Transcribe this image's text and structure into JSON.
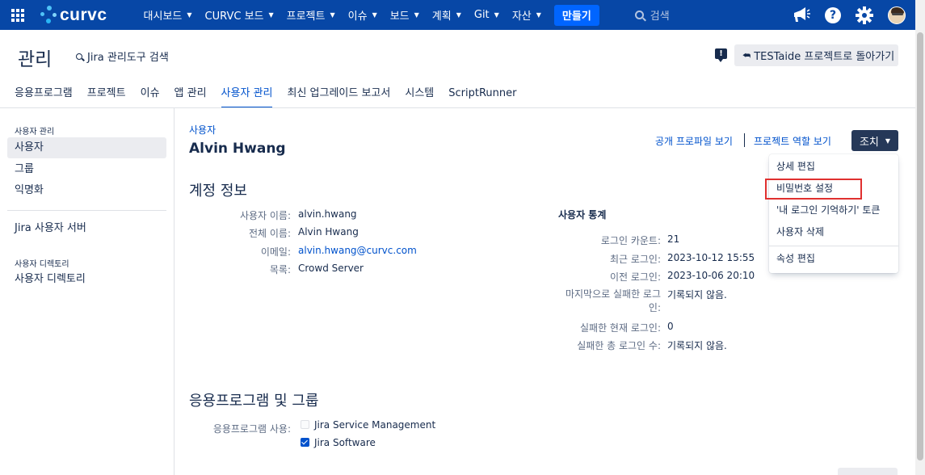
{
  "topnav": {
    "logo_text": "curvc",
    "items": [
      {
        "label": "대시보드"
      },
      {
        "label": "CURVC 보드"
      },
      {
        "label": "프로젝트"
      },
      {
        "label": "이슈"
      },
      {
        "label": "보드"
      },
      {
        "label": "계획"
      },
      {
        "label": "Git"
      },
      {
        "label": "자산"
      }
    ],
    "create_label": "만들기",
    "search_placeholder": "검색",
    "help_label": "?"
  },
  "admin": {
    "title": "관리",
    "search_label": "Jira 관리도구 검색",
    "feedback_icon_label": "!",
    "back_label": "TESTaide 프로젝트로 돌아가기",
    "back_arrow": "⮪",
    "tabs": [
      {
        "label": "응용프로그램"
      },
      {
        "label": "프로젝트"
      },
      {
        "label": "이슈"
      },
      {
        "label": "앱 관리"
      },
      {
        "label": "사용자 관리"
      },
      {
        "label": "최신 업그레이드 보고서"
      },
      {
        "label": "시스템"
      },
      {
        "label": "ScriptRunner"
      }
    ],
    "active_tab": "사용자 관리"
  },
  "sidebar": {
    "heading_users": "사용자 관리",
    "items": [
      {
        "label": "사용자"
      },
      {
        "label": "그룹"
      },
      {
        "label": "익명화"
      },
      {
        "label": "Jira 사용자 서버"
      }
    ],
    "heading_directory": "사용자 디렉토리",
    "directory_item": "사용자 디렉토리"
  },
  "main": {
    "breadcrumb": "사용자",
    "user_name": "Alvin Hwang",
    "link_profile": "공개 프로파일 보기",
    "link_roles": "프로젝트 역할 보기",
    "actions_label": "조치",
    "account_title": "계정 정보",
    "account": [
      {
        "label": "사용자 이름:",
        "value": "alvin.hwang"
      },
      {
        "label": "전체 이름:",
        "value": "Alvin Hwang"
      },
      {
        "label": "이메일:",
        "value": "alvin.hwang@curvc.com"
      },
      {
        "label": "목록:",
        "value": "Crowd Server"
      }
    ],
    "stats_title": "사용자 통계",
    "stats": [
      {
        "label": "로그인 카운트:",
        "value": "21"
      },
      {
        "label": "최근 로그인:",
        "value": "2023-10-12 15:55"
      },
      {
        "label": "이전 로그인:",
        "value": "2023-10-06 20:10"
      },
      {
        "label": "마지막으로 실패한 로그인:",
        "value": "기록되지 않음."
      },
      {
        "label": "실패한 현재 로그인:",
        "value": "0"
      },
      {
        "label": "실패한 총 로그인 수:",
        "value": "기록되지 않음."
      }
    ],
    "apps_title": "응용프로그램 및 그룹",
    "apps_label": "응용프로그램 사용:",
    "apps": [
      {
        "label": "Jira Service Management",
        "checked": false
      },
      {
        "label": "Jira Software",
        "checked": true
      }
    ]
  },
  "dropdown": {
    "items": [
      {
        "label": "상세 편집"
      },
      {
        "label": "비밀번호 설정"
      },
      {
        "label": "'내 로그인 기억하기' 토큰"
      },
      {
        "label": "사용자 삭제"
      },
      {
        "label": "속성 편집"
      }
    ],
    "highlighted": "비밀번호 설정",
    "highlight_color": "#e0302f"
  },
  "colors": {
    "nav_bg": "#0747a6",
    "link": "#0052cc",
    "actions_bg": "#253858"
  }
}
